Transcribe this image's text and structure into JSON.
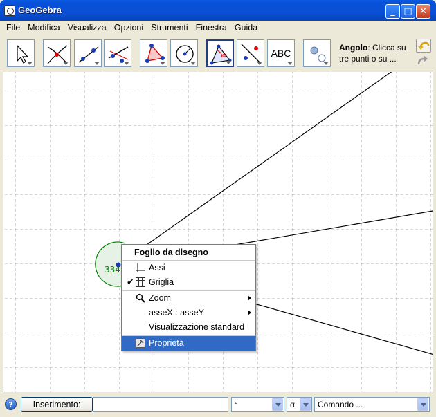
{
  "window": {
    "title": "GeoGebra",
    "controls": {
      "minimize": "_",
      "maximize": "□",
      "close": "✕"
    }
  },
  "menu": {
    "items": [
      "File",
      "Modifica",
      "Visualizza",
      "Opzioni",
      "Strumenti",
      "Finestra",
      "Guida"
    ]
  },
  "toolbar": {
    "tools": [
      {
        "name": "move-tool-icon"
      },
      {
        "name": "intersect-point-tool-icon"
      },
      {
        "name": "line-tool-icon"
      },
      {
        "name": "perpendicular-line-tool-icon"
      },
      {
        "name": "polygon-tool-icon"
      },
      {
        "name": "circle-tool-icon"
      },
      {
        "name": "angle-tool-icon",
        "selected": true
      },
      {
        "name": "reflect-tool-icon"
      },
      {
        "name": "text-tool-icon",
        "label": "ABC"
      },
      {
        "name": "slider-tool-icon"
      }
    ],
    "help_title": "Angolo",
    "help_text": ": Clicca su tre punti o su ..."
  },
  "canvas": {
    "angle_label": "334.",
    "accent_green": "#007F00"
  },
  "context_menu": {
    "title": "Foglio da disegno",
    "items": {
      "axes": "Assi",
      "grid": "Griglia",
      "zoom": "Zoom",
      "axes_ratio": "asseX : asseY",
      "standard_view": "Visualizzazione standard",
      "properties": "Proprietà"
    },
    "highlight_color": "#316AC5"
  },
  "input_bar": {
    "button_label": "Inserimento:",
    "input_value": "",
    "degree_combo": "°",
    "alpha_combo": "α",
    "command_combo": "Comando ..."
  }
}
